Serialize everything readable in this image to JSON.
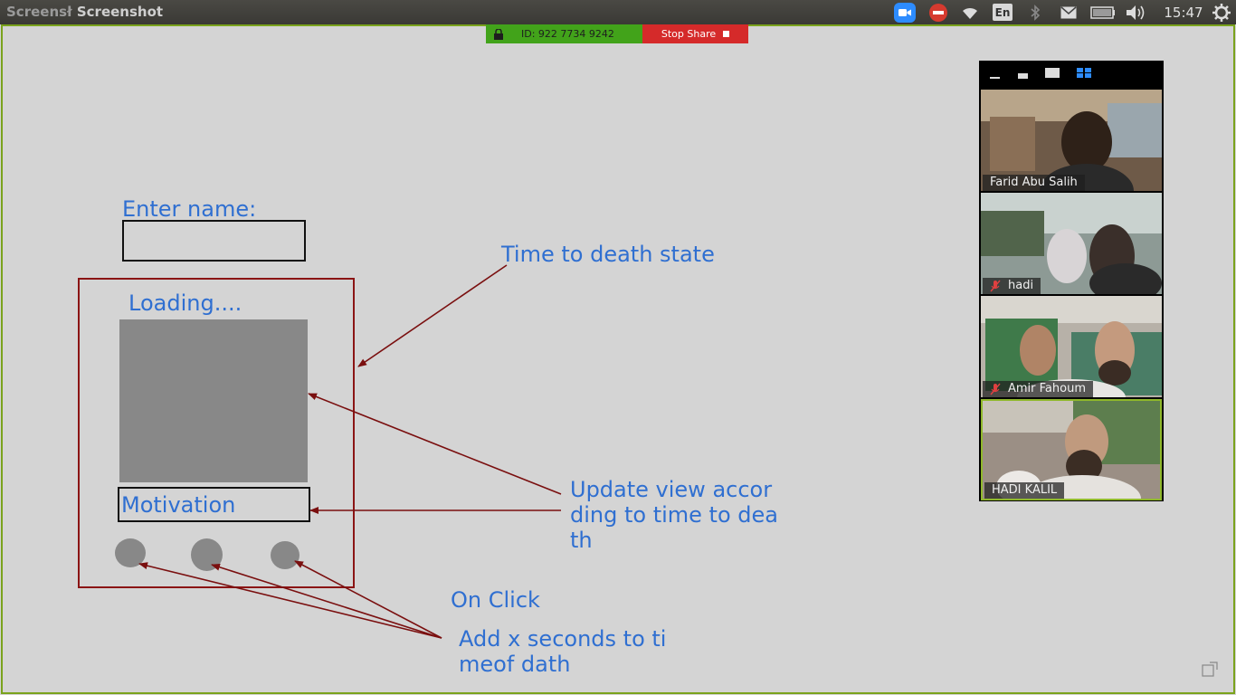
{
  "topbar": {
    "app_title": "Screenshot",
    "app_title_truncated": "Screensł",
    "clock": "15:47",
    "language": "En",
    "icons": [
      "zoom-camera-icon",
      "do-not-disturb-icon",
      "wifi-icon",
      "language-indicator",
      "bluetooth-icon",
      "mail-icon",
      "battery-icon",
      "volume-icon",
      "clock",
      "power-settings-icon"
    ]
  },
  "share_bar": {
    "meeting_id": "ID: 922 7734 9242",
    "stop_label": "Stop Share"
  },
  "wireframe": {
    "enter_name_label": "Enter name:",
    "loading_label": "Loading....",
    "motivation_label": "Motivation",
    "annotation_time_state": "Time to death state",
    "annotation_update_view": "Update view accor\nding to time to dea\nth",
    "annotation_on_click": "On Click",
    "annotation_add_seconds": "Add x seconds to ti\nmeof dath",
    "colors": {
      "text": "#2f6fd1",
      "arrow": "#7a0f0f",
      "box": "#8b1414"
    }
  },
  "video_panel": {
    "participants": [
      {
        "name": "Farid Abu Salih",
        "muted": false,
        "active": false
      },
      {
        "name": "hadi",
        "muted": true,
        "active": false
      },
      {
        "name": "Amir Fahoum",
        "muted": true,
        "active": false
      },
      {
        "name": "HADI KALIL",
        "muted": false,
        "active": true
      }
    ],
    "active_border_color": "#8fb82b"
  }
}
